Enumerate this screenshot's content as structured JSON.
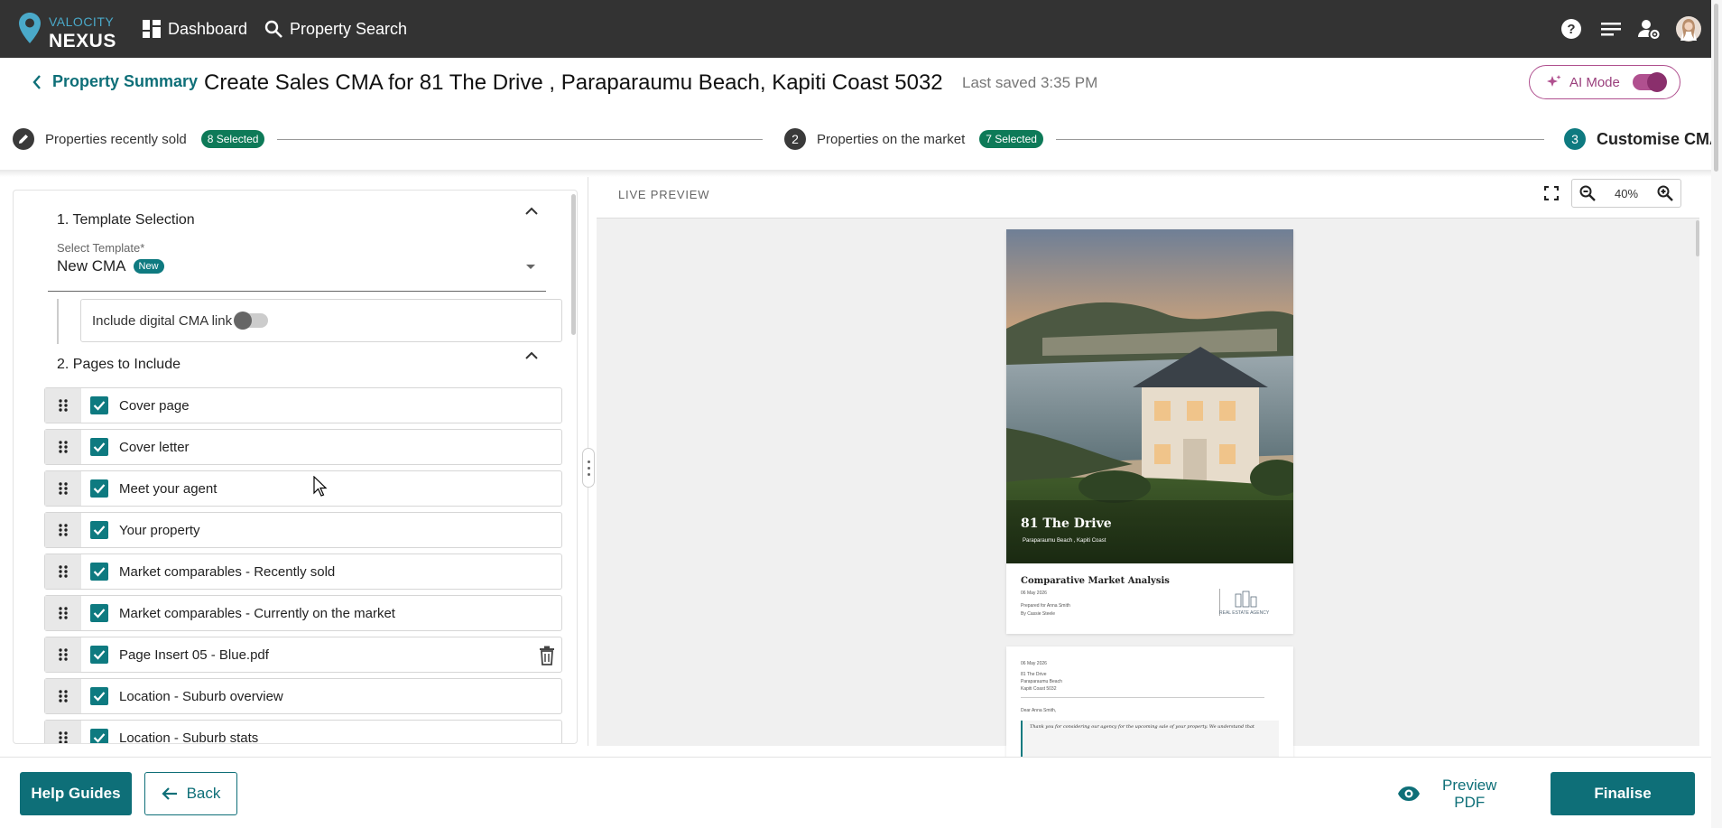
{
  "app": {
    "logo_line1": "VALOCITY",
    "logo_line2": "NEXUS",
    "nav": [
      {
        "label": "Dashboard",
        "icon": "dashboard-icon"
      },
      {
        "label": "Property Search",
        "icon": "search-icon"
      }
    ],
    "top_icons": [
      "help-icon",
      "menu-lines-icon",
      "user-settings-icon",
      "avatar"
    ]
  },
  "header": {
    "back_label": "Property Summary",
    "title": "Create Sales CMA for 81 The Drive , Paraparaumu Beach, Kapiti Coast 5032",
    "last_saved": "Last saved 3:35 PM",
    "ai_mode_label": "AI Mode",
    "ai_mode_on": true
  },
  "stepper": {
    "steps": [
      {
        "num": "",
        "icon": "pencil-icon",
        "label": "Properties recently sold",
        "badge": "8 Selected"
      },
      {
        "num": "2",
        "label": "Properties on the market",
        "badge": "7 Selected"
      },
      {
        "num": "3",
        "label": "Customise CMA",
        "active": true
      }
    ]
  },
  "left": {
    "section1_title": "1. Template Selection",
    "template_label": "Select Template*",
    "template_value": "New CMA",
    "template_badge": "New",
    "digital_link_label": "Include digital CMA link",
    "digital_link_on": false,
    "section2_title": "2. Pages to Include",
    "pages": [
      {
        "label": "Cover page",
        "checked": true
      },
      {
        "label": "Cover letter",
        "checked": true
      },
      {
        "label": "Meet your agent",
        "checked": true
      },
      {
        "label": "Your property",
        "checked": true
      },
      {
        "label": "Market comparables - Recently sold",
        "checked": true
      },
      {
        "label": "Market comparables - Currently on the market",
        "checked": true
      },
      {
        "label": "Page Insert 05 - Blue.pdf",
        "checked": true,
        "deletable": true
      },
      {
        "label": "Location - Suburb overview",
        "checked": true
      },
      {
        "label": "Location - Suburb stats",
        "checked": true
      }
    ]
  },
  "preview": {
    "label": "LIVE PREVIEW",
    "zoom": "40%",
    "cover": {
      "title": "81 The Drive",
      "location": "Paraparaumu Beach , Kapiti Coast",
      "subtitle": "Comparative Market Analysis",
      "date": "06 May 2026",
      "prepared_for": "Prepared for Anna Smith",
      "by": "By Cassie Steele",
      "agency": "REAL ESTATE AGENCY"
    },
    "letter": {
      "date": "06 May 2026",
      "addr1": "81 The Drive",
      "addr2": "Paraparaumu Beach",
      "addr3": "Kapiti Coast 5032",
      "greeting": "Dear Anna Smith,",
      "quote": "Thank you for considering our agency for the upcoming sale of your property. We understand that"
    }
  },
  "footer": {
    "help_label": "Help Guides",
    "back_label": "Back",
    "preview_line1": "Preview",
    "preview_line2": "PDF",
    "finalise_label": "Finalise"
  },
  "colors": {
    "topbar": "#333333",
    "teal": "#0e6f78",
    "badge_green": "#0e7a58",
    "ai_magenta": "#b0508f"
  }
}
